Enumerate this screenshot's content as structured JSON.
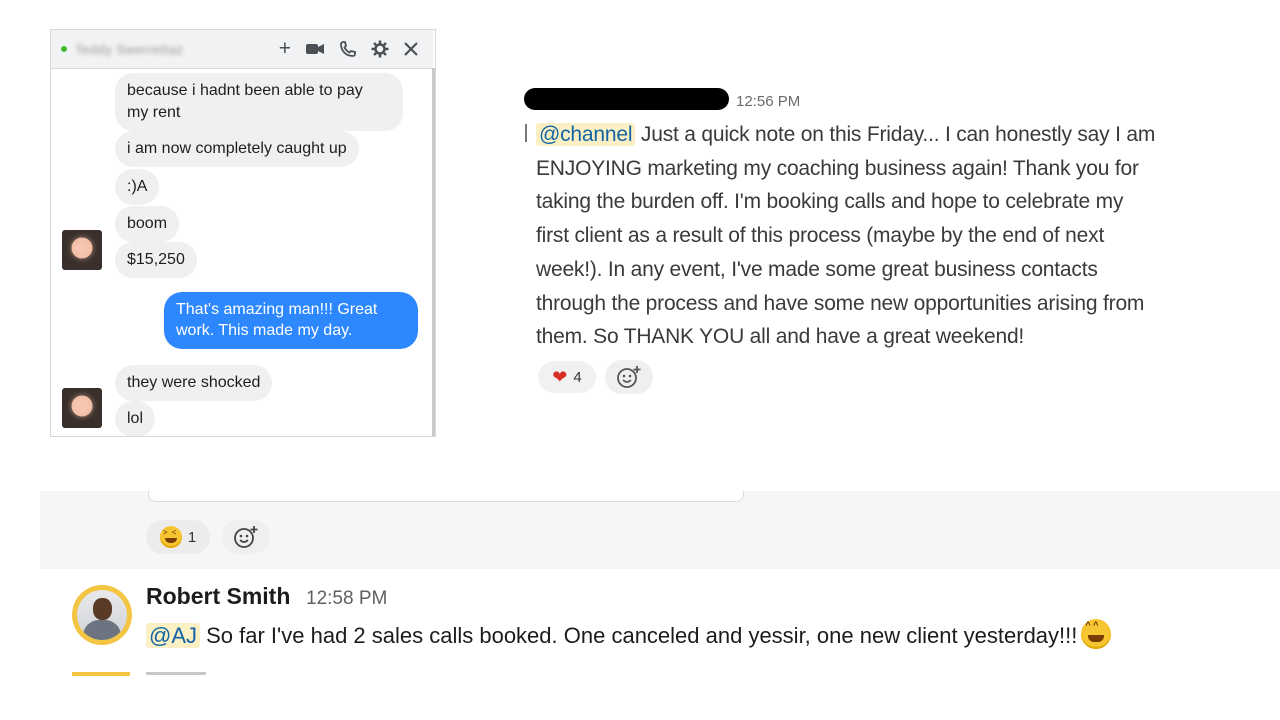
{
  "messenger": {
    "contact_name": "Teddy Swerrettaz",
    "header_icons": [
      "add-icon",
      "video-call-icon",
      "phone-icon",
      "settings-icon",
      "close-icon"
    ],
    "header_glyphs": {
      "add": "+",
      "video": "■",
      "phone": "✆",
      "settings": "✲",
      "close": "✕"
    },
    "messages": [
      {
        "from": "them",
        "text_lines": [
          "because i hadnt been able to pay",
          "my rent"
        ]
      },
      {
        "from": "them",
        "text": "i am now completely caught up"
      },
      {
        "from": "them",
        "text": ":)A"
      },
      {
        "from": "them",
        "text": "boom"
      },
      {
        "from": "them",
        "text": "$15,250"
      },
      {
        "from": "me",
        "text_lines": [
          "That's amazing man!!! Great",
          "work. This made my day."
        ]
      },
      {
        "from": "them",
        "text": "they were shocked"
      },
      {
        "from": "them",
        "text": "lol"
      }
    ],
    "colors": {
      "my_bubble": "#2d88ff",
      "their_bubble": "#f0f0f0",
      "online": "#42b72a"
    }
  },
  "slack_top": {
    "time": "12:56 PM",
    "mention": "@channel",
    "lines": [
      " Just a quick note on this Friday... I can honestly say I am",
      "ENJOYING marketing my coaching business again! Thank you for",
      "taking the burden off. I'm booking calls and hope to celebrate my",
      "first client as a result of this process (maybe by the end of next",
      "week!). In any event, I've made some great business contacts",
      "through the process and have some new opportunities arising from",
      "them. So THANK YOU all and have a great weekend!"
    ],
    "reaction": {
      "emoji": "❤",
      "emoji_name": "heart",
      "count": "4"
    },
    "add_reaction_icon": "add-reaction-icon"
  },
  "slack_middle": {
    "reaction": {
      "emoji_name": "laughing",
      "count": "1"
    },
    "add_reaction_icon": "add-reaction-icon"
  },
  "slack_bottom": {
    "author": "Robert Smith",
    "time": "12:58 PM",
    "mention": "@AJ",
    "text": " So far I've had 2 sales calls booked. One canceled and yessir, one new client yesterday!!!",
    "trailing_emoji": "grin"
  },
  "colors": {
    "mention_bg": "#fbefc4",
    "mention_fg": "#1264a3",
    "avatar_ring": "#f4c542"
  }
}
